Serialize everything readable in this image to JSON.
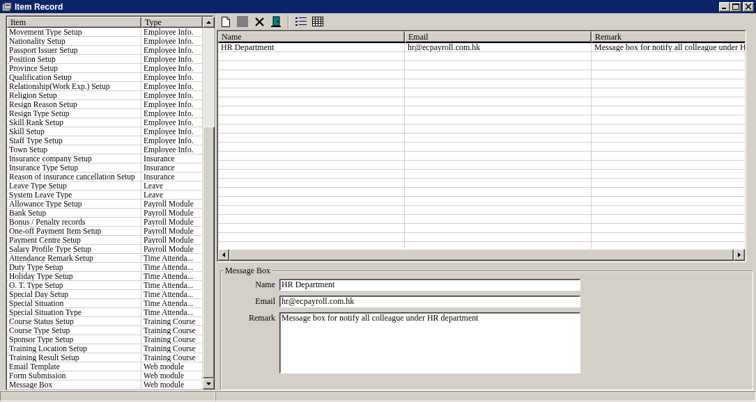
{
  "window": {
    "title": "Item Record"
  },
  "item_list": {
    "columns": [
      "Item",
      "Type"
    ],
    "rows": [
      {
        "item": "Movement Type Setup",
        "type": "Employee Info."
      },
      {
        "item": "Nationality Setup",
        "type": "Employee Info."
      },
      {
        "item": "Passport Issuer Setup",
        "type": "Employee Info."
      },
      {
        "item": "Position Setup",
        "type": "Employee Info."
      },
      {
        "item": "Province Setup",
        "type": "Employee Info."
      },
      {
        "item": "Qualification Setup",
        "type": "Employee Info."
      },
      {
        "item": "Relationship(Work Exp.) Setup",
        "type": "Employee Info."
      },
      {
        "item": "Religion Setup",
        "type": "Employee Info."
      },
      {
        "item": "Resign Reason Setup",
        "type": "Employee Info."
      },
      {
        "item": "Resign Type Setup",
        "type": "Employee Info."
      },
      {
        "item": "Skill Rank Setup",
        "type": "Employee Info."
      },
      {
        "item": "Skill Setup",
        "type": "Employee Info."
      },
      {
        "item": "Staff Type Setup",
        "type": "Employee Info."
      },
      {
        "item": "Town Setup",
        "type": "Employee Info."
      },
      {
        "item": "Insurance company Setup",
        "type": "Insurance"
      },
      {
        "item": "Insurance Type Setup",
        "type": "Insurance"
      },
      {
        "item": "Reason of insurance cancellation Setup",
        "type": "Insurance"
      },
      {
        "item": "Leave Type Setup",
        "type": "Leave"
      },
      {
        "item": "System Leave Type",
        "type": "Leave"
      },
      {
        "item": "Allowance Type Setup",
        "type": "Payroll Module"
      },
      {
        "item": "Bank Setup",
        "type": "Payroll Module"
      },
      {
        "item": "Bonus / Penalty records",
        "type": "Payroll Module"
      },
      {
        "item": "One-off Payment Item Setup",
        "type": "Payroll Module"
      },
      {
        "item": "Payment Centre Setup",
        "type": "Payroll Module"
      },
      {
        "item": "Salary Profile Type Setup",
        "type": "Payroll Module"
      },
      {
        "item": "Attendance Remark Setup",
        "type": "Time Attenda..."
      },
      {
        "item": "Duty Type Setup",
        "type": "Time Attenda..."
      },
      {
        "item": "Holiday Type Setup",
        "type": "Time Attenda..."
      },
      {
        "item": "O. T. Type Setup",
        "type": "Time Attenda..."
      },
      {
        "item": "Special Day Setup",
        "type": "Time Attenda..."
      },
      {
        "item": "Special Situation",
        "type": "Time Attenda..."
      },
      {
        "item": "Special Situation Type",
        "type": "Time Attenda..."
      },
      {
        "item": "Course Status Setup",
        "type": "Training Course"
      },
      {
        "item": "Course Type Setup",
        "type": "Training Course"
      },
      {
        "item": "Sponsor Type Setup",
        "type": "Training Course"
      },
      {
        "item": "Training Location Setup",
        "type": "Training Course"
      },
      {
        "item": "Training Result Setup",
        "type": "Training Course"
      },
      {
        "item": "Email Template",
        "type": "Web module"
      },
      {
        "item": "Form Submission",
        "type": "Web module"
      },
      {
        "item": "Message Box",
        "type": "Web module"
      }
    ]
  },
  "grid": {
    "columns": [
      "Name",
      "Email",
      "Remark"
    ],
    "rows": [
      {
        "cells": [
          "HR Department",
          "hr@ecpayroll.com.hk",
          "Message box for notify all colleague under H"
        ]
      }
    ]
  },
  "form": {
    "title": "Message Box",
    "fields": [
      {
        "label": "Name",
        "value": "HR Department",
        "kind": "line"
      },
      {
        "label": "Email",
        "value": "hr@ecpayroll.com.hk",
        "kind": "line"
      },
      {
        "label": "Remark",
        "value": "Message box for notify all colleague under HR department",
        "kind": "multiline"
      }
    ]
  }
}
